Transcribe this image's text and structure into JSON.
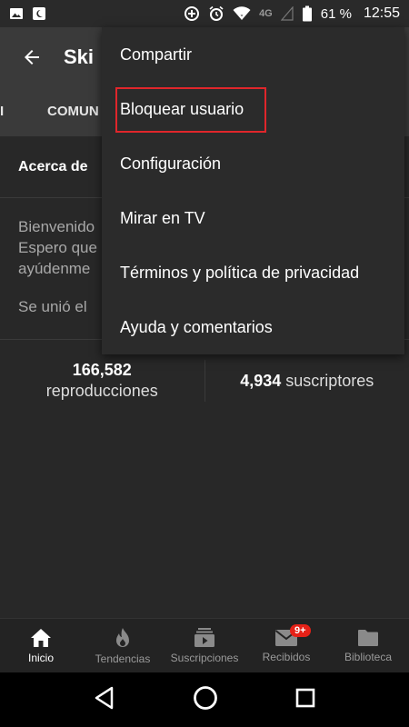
{
  "status_bar": {
    "battery": "61 %",
    "network": "4G",
    "time": "12:55"
  },
  "app_bar": {
    "title": "Ski"
  },
  "tabs": {
    "partial_left": "I",
    "community": "COMUN"
  },
  "about": {
    "heading": "Acerca de",
    "description": "Bienvenido\nEspero que\nayúdenme",
    "joined": "Se unió el"
  },
  "stats": {
    "views_count": "166,582",
    "views_label": "reproducciones",
    "subs_count": "4,934",
    "subs_label": "suscriptores"
  },
  "menu": {
    "items": [
      "Compartir",
      "Bloquear usuario",
      "Configuración",
      "Mirar en TV",
      "Términos y política de privacidad",
      "Ayuda y comentarios"
    ],
    "highlight_color": "#e0262b"
  },
  "bottom_nav": {
    "items": [
      {
        "label": "Inicio",
        "icon": "home-icon"
      },
      {
        "label": "Tendencias",
        "icon": "flame-icon"
      },
      {
        "label": "Suscripciones",
        "icon": "subscriptions-icon"
      },
      {
        "label": "Recibidos",
        "icon": "inbox-icon",
        "badge": "9+"
      },
      {
        "label": "Biblioteca",
        "icon": "folder-icon"
      }
    ],
    "badge_color": "#e62117"
  }
}
